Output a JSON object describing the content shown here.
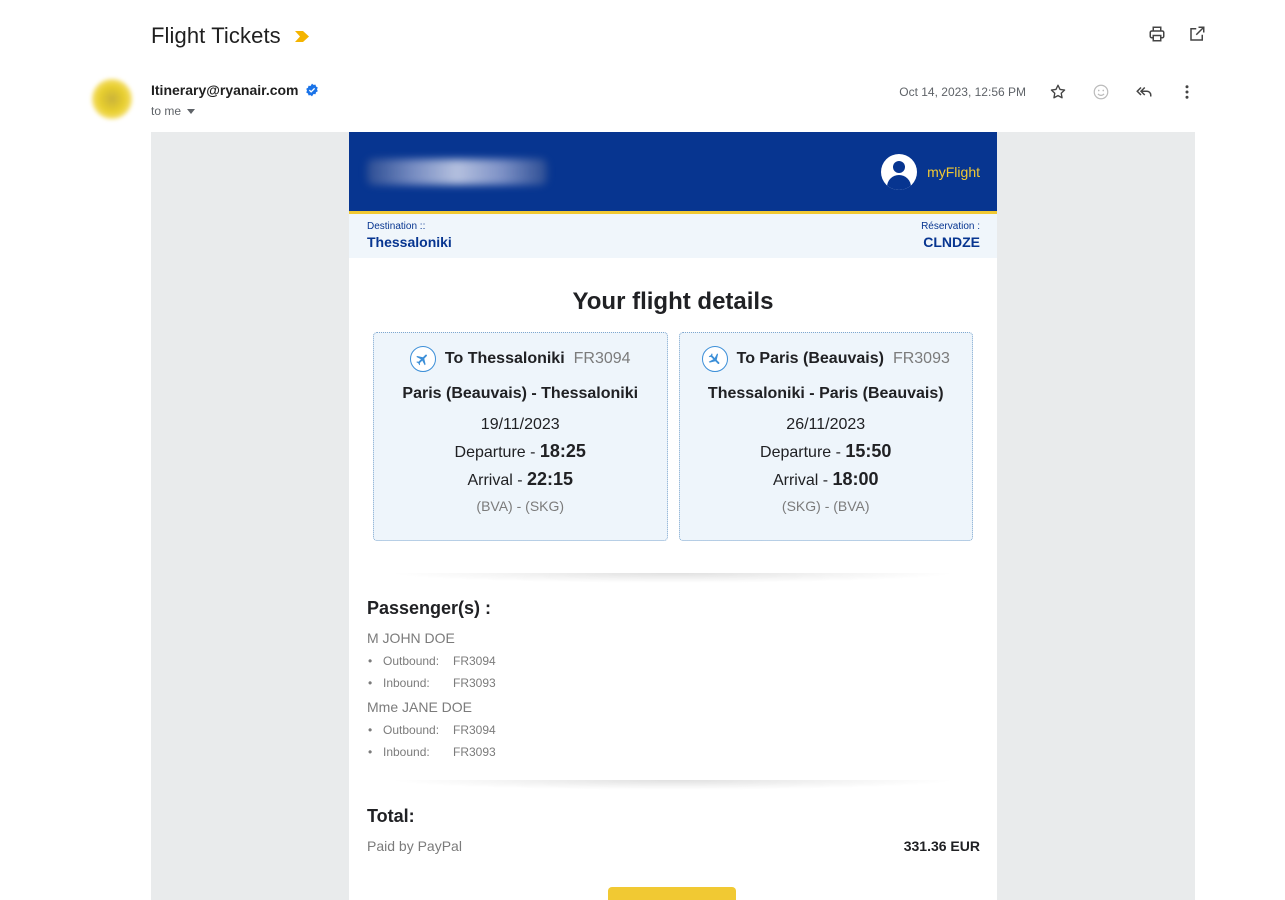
{
  "email": {
    "subject": "Flight Tickets",
    "sender": "Itinerary@ryanair.com",
    "to": "to me",
    "date": "Oct 14, 2023, 12:56 PM"
  },
  "ryanair": {
    "myflight_label": "myFlight",
    "destination_label": "Destination ::",
    "destination": "Thessaloniki",
    "reservation_label": "Réservation :",
    "reservation": "CLNDZE",
    "details_title": "Your flight details",
    "flights": [
      {
        "to": "To Thessaloniki",
        "flight_no": "FR3094",
        "route": "Paris (Beauvais) - Thessaloniki",
        "date": "19/11/2023",
        "departure_label": "Departure - ",
        "departure": "18:25",
        "arrival_label": "Arrival - ",
        "arrival": "22:15",
        "codes": "(BVA) - (SKG)"
      },
      {
        "to": "To Paris (Beauvais)",
        "flight_no": "FR3093",
        "route": "Thessaloniki - Paris (Beauvais)",
        "date": "26/11/2023",
        "departure_label": "Departure - ",
        "departure": "15:50",
        "arrival_label": "Arrival - ",
        "arrival": "18:00",
        "codes": "(SKG) - (BVA)"
      }
    ],
    "passengers_title": "Passenger(s) :",
    "passengers": [
      {
        "name": "M JOHN DOE",
        "segments": [
          {
            "label": "Outbound:",
            "flight": "FR3094"
          },
          {
            "label": "Inbound:",
            "flight": "FR3093"
          }
        ]
      },
      {
        "name": "Mme JANE DOE",
        "segments": [
          {
            "label": "Outbound:",
            "flight": "FR3094"
          },
          {
            "label": "Inbound:",
            "flight": "FR3093"
          }
        ]
      }
    ],
    "total_title": "Total:",
    "paid_by": "Paid by PayPal",
    "amount": "331.36 EUR"
  },
  "colors": {
    "ryanair_blue": "#073590",
    "ryanair_yellow": "#f1c933",
    "card_bg": "#eef5fb",
    "muted_text": "#7b7b7b"
  },
  "icons": {
    "importance": "importance-marker-icon",
    "print": "print-icon",
    "new_window": "open-in-new-window-icon",
    "verified": "verified-badge-icon",
    "star": "star-icon",
    "emoji": "emoji-icon",
    "reply_all": "reply-all-icon",
    "more": "more-vert-icon",
    "user": "user-icon",
    "plane": "airplane-icon"
  }
}
